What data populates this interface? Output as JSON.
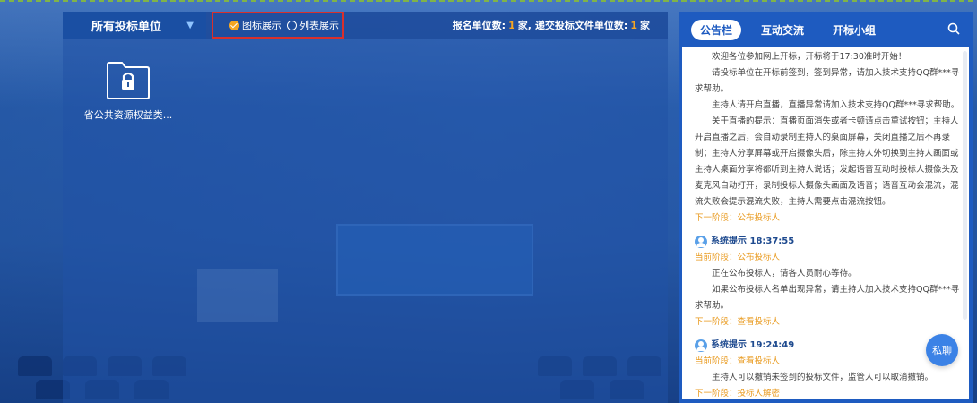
{
  "toolbar": {
    "unit_select": "所有投标单位",
    "view_icon": "图标展示",
    "view_list": "列表展示",
    "registered_label": "报名单位数:",
    "registered_count": "1",
    "registered_unit": "家,",
    "submitted_label": "递交投标文件单位数:",
    "submitted_count": "1",
    "submitted_unit": "家"
  },
  "folder": {
    "label": "省公共资源权益类..."
  },
  "side": {
    "tabs": [
      "公告栏",
      "互动交流",
      "开标小组"
    ],
    "notice": [
      "欢迎各位参加网上开标，开标将于17:30准时开始！",
      "请投标单位在开标前签到，签到异常，请加入技术支持QQ群***寻求帮助。",
      "主持人请开启直播，直播异常请加入技术支持QQ群***寻求帮助。",
      "关于直播的提示：直播页面消失或者卡顿请点击重试按钮；主持人开启直播之后，会自动录制主持人的桌面屏幕，关闭直播之后不再录制；主持人分享屏幕或开启摄像头后，除主持人外切换到主持人画面或主持人桌面分享将都听到主持人说话；发起语音互动时投标人摄像头及麦克风自动打开，录制投标人摄像头画面及语音；语音互动会混流，混流失败会提示混流失败，主持人需要点击混流按钮。"
    ],
    "notice_next": "下一阶段：公布投标人",
    "messages": [
      {
        "title": "系统提示 18:37:55",
        "current": "当前阶段：公布投标人",
        "lines": [
          "正在公布投标人，请各人员耐心等待。",
          "如果公布投标人名单出现异常，请主持人加入技术支持QQ群***寻求帮助。"
        ],
        "next": "下一阶段：查看投标人"
      },
      {
        "title": "系统提示 19:24:49",
        "current": "当前阶段：查看投标人",
        "lines": [
          "主持人可以撤销未签到的投标文件，监管人可以取消撤销。"
        ],
        "next": "下一阶段：投标人解密"
      }
    ],
    "chat_button": "私聊"
  }
}
